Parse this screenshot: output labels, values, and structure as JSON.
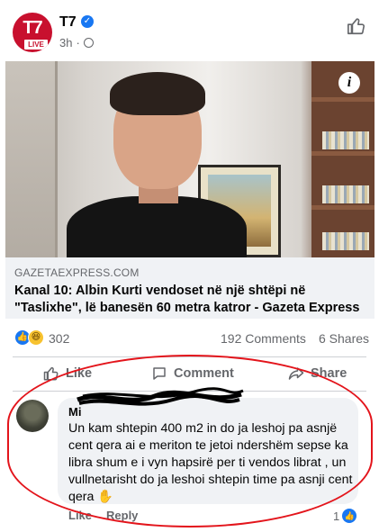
{
  "post": {
    "page_name": "T7",
    "logo_text": "T7",
    "logo_badge": "LIVE",
    "time": "3h",
    "separator": "·"
  },
  "video": {
    "info_label": "i"
  },
  "link": {
    "source": "GAZETAEXPRESS.COM",
    "title": "Kanal 10: Albin Kurti vendoset në një shtëpi në \"Taslixhe\", lë banesën 60 metra katror - Gazeta Express"
  },
  "stats": {
    "reactions_count": "302",
    "comments": "192 Comments",
    "shares": "6 Shares"
  },
  "actions": {
    "like": "Like",
    "comment": "Comment",
    "share": "Share"
  },
  "comment": {
    "author_initial": "Mi",
    "text": "Un kam shtepin 400 m2 in do ja leshoj pa asnjë cent qera ai e meriton te jetoi ndershëm sepse ka libra shum e i vyn hapsirë per ti vendos librat , un vullnetarisht do ja leshoi shtepin time pa asnji cent qera",
    "emoji": "✋",
    "like_label": "Like",
    "reply_label": "Reply",
    "reaction_count": "1"
  },
  "colors": {
    "accent": "#1877f2",
    "brand_red": "#c8102e",
    "highlight_red": "#e3141b",
    "muted_text": "#65676b",
    "bubble_bg": "#f0f2f5"
  },
  "icons": {
    "verified": "verified-badge-icon",
    "audience": "globe-icon",
    "like": "thumbs-up-icon",
    "comment": "speech-bubble-icon",
    "share": "share-arrow-icon",
    "info": "info-icon"
  }
}
